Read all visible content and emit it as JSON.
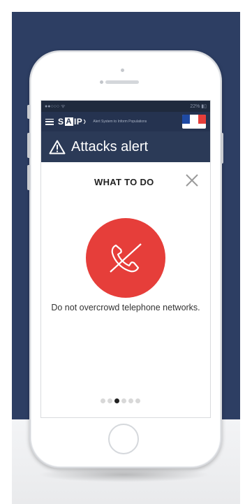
{
  "status_bar": {
    "left": "●●○○○ ᯤ",
    "right": "22% ▮▯"
  },
  "header": {
    "logo_pre": "S",
    "logo_box": "A",
    "logo_post": "IP",
    "tagline": "Alert System to Inform Populations",
    "flag_colors": [
      "#1f4aa3",
      "#ffffff",
      "#e63e3a"
    ]
  },
  "alert": {
    "title": "Attacks alert"
  },
  "card": {
    "title": "WHAT TO DO",
    "advice": "Do not overcrowd telephone networks.",
    "accent_color": "#e63e3a",
    "icon": "no-phone-icon"
  },
  "pager": {
    "total": 6,
    "active_index": 2
  }
}
